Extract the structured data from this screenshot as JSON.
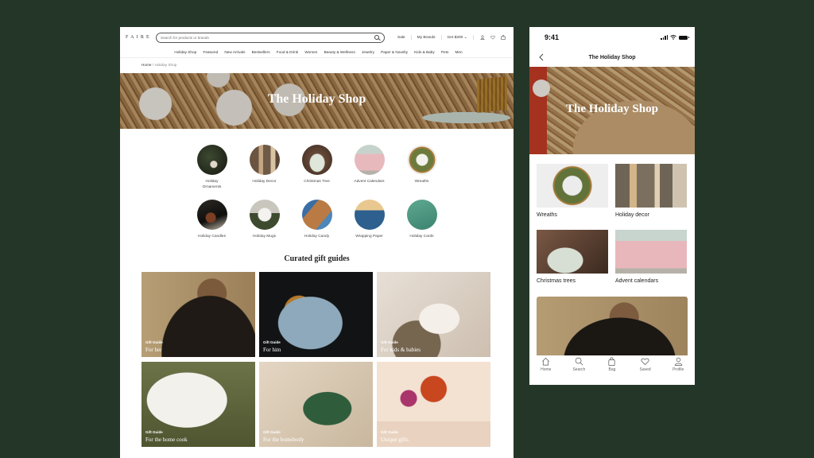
{
  "desktop": {
    "logo": "FAIRE",
    "search": {
      "placeholder": "Search for products or brands",
      "value": ""
    },
    "header_links": [
      "Sale",
      "My Brands",
      "Get $300"
    ],
    "header_icons": [
      "account-icon",
      "heart-icon",
      "bag-icon"
    ],
    "nav": [
      "Holiday Shop",
      "Featured",
      "New Arrivals",
      "Bestsellers",
      "Food & Drink",
      "Women",
      "Beauty & Wellness",
      "Jewelry",
      "Paper & Novelty",
      "Kids & Baby",
      "Pets",
      "Men"
    ],
    "breadcrumb": {
      "home": "Home",
      "separator": " / ",
      "current": "Holiday Shop"
    },
    "hero_title": "The Holiday Shop",
    "categories": [
      {
        "label": "Holiday Ornaments",
        "img": "ornaments"
      },
      {
        "label": "Holiday Decor",
        "img": "decor"
      },
      {
        "label": "Christmas Tree",
        "img": "tree"
      },
      {
        "label": "Advent Calendars",
        "img": "advent"
      },
      {
        "label": "Wreaths",
        "img": "wreaths"
      },
      {
        "label": "Holiday Candles",
        "img": "candles"
      },
      {
        "label": "Holiday Mugs",
        "img": "mugs"
      },
      {
        "label": "Holiday Candy",
        "img": "candy"
      },
      {
        "label": "Wrapping Paper",
        "img": "wrapping"
      },
      {
        "label": "Holiday Cards",
        "img": "cards"
      }
    ],
    "section_title": "Curated gift guides",
    "guides": [
      {
        "kicker": "Gift Guide",
        "title": "For her",
        "img": "her"
      },
      {
        "kicker": "Gift Guide",
        "title": "For him",
        "img": "him"
      },
      {
        "kicker": "Gift Guide",
        "title": "For kids & babies",
        "img": "kids"
      },
      {
        "kicker": "Gift Guide",
        "title": "For the home cook",
        "img": "cook"
      },
      {
        "kicker": "Gift Guide",
        "title": "For the homebody",
        "img": "homebody"
      },
      {
        "kicker": "Gift Guide",
        "title": "Unique gifts",
        "img": "unique"
      }
    ]
  },
  "mobile": {
    "time": "9:41",
    "title": "The Holiday Shop",
    "hero_title": "The Holiday Shop",
    "tiles": [
      {
        "label": "Wreaths",
        "img": "wreaths"
      },
      {
        "label": "Holiday decor",
        "img": "decor"
      },
      {
        "label": "Christmas trees",
        "img": "trees"
      },
      {
        "label": "Advent calendars",
        "img": "advent"
      }
    ],
    "tabs": [
      {
        "label": "Home",
        "icon": "home-icon"
      },
      {
        "label": "Search",
        "icon": "search-icon"
      },
      {
        "label": "Bag",
        "icon": "bag-icon"
      },
      {
        "label": "Saved",
        "icon": "heart-icon"
      },
      {
        "label": "Profile",
        "icon": "profile-icon"
      }
    ]
  },
  "colors": {
    "background": "#243628",
    "surface": "#ffffff",
    "text": "#333333"
  }
}
